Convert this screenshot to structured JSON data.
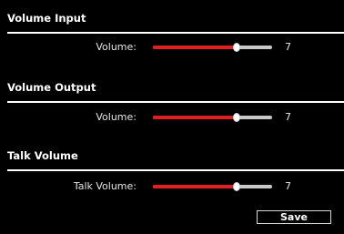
{
  "sections": [
    {
      "title": "Volume Input",
      "label": "Volume:",
      "value": "7",
      "level": 0.7
    },
    {
      "title": "Volume Output",
      "label": "Volume:",
      "value": "7",
      "level": 0.7
    },
    {
      "title": "Talk Volume",
      "label": "Talk Volume:",
      "value": "7",
      "level": 0.7
    }
  ],
  "save_label": "Save",
  "colors": {
    "background": "#000000",
    "slider_fill": "#e02020",
    "slider_track": "#c8c8c8",
    "text": "#ffffff"
  }
}
